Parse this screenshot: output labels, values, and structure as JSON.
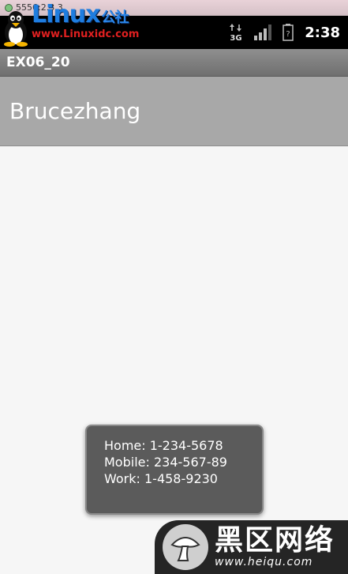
{
  "window": {
    "title": "5556:2.3.3"
  },
  "watermark_top": {
    "brand": "Linux",
    "brand_cn": "公社",
    "url": "www.Linuxidc.com"
  },
  "status_bar": {
    "network": "3G",
    "time": "2:38",
    "battery_label": "?"
  },
  "app": {
    "title": "EX06_20"
  },
  "list": {
    "items": [
      {
        "name": "Brucezhang"
      }
    ]
  },
  "toast": {
    "home": "Home: 1-234-5678",
    "mobile": "Mobile: 234-567-89",
    "work": "Work: 1-458-9230"
  },
  "watermark_bottom": {
    "cn": "黑区网络",
    "url": "www.heiqu.com"
  }
}
